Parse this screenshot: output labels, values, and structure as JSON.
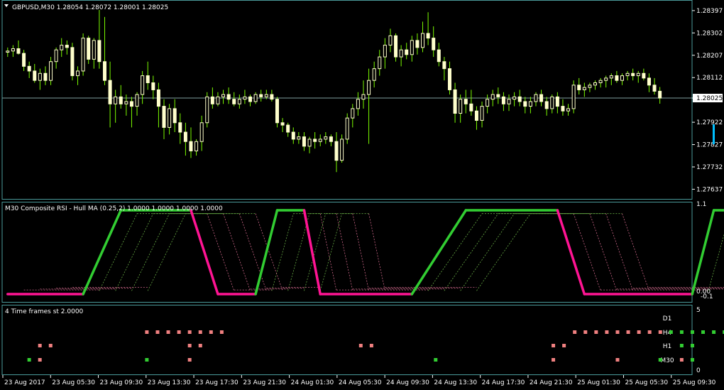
{
  "chart_data": [
    {
      "type": "candlestick",
      "title": "GBPUSD,M30  1.28054 1.28072 1.28001 1.28025",
      "symbol": "GBPUSD",
      "timeframe": "M30",
      "ohlc_header": {
        "open": "1.28054",
        "high": "1.28072",
        "low": "1.28001",
        "close": "1.28025"
      },
      "current_price": "1.28025",
      "yticks": [
        "1.28397",
        "1.28302",
        "1.28207",
        "1.28112",
        "1.28025",
        "1.27922",
        "1.27827",
        "1.27732",
        "1.27637"
      ],
      "ylim": [
        1.27605,
        1.2843
      ],
      "colors": {
        "bull": "#ffffcc",
        "bear": "#ffffcc",
        "wick": "#7cfc00",
        "price_line": "#7fa0a0"
      },
      "candles": [
        [
          1.2822,
          1.2824,
          1.282,
          1.28225
        ],
        [
          1.28225,
          1.2825,
          1.282,
          1.28235
        ],
        [
          1.28235,
          1.2827,
          1.2821,
          1.28215
        ],
        [
          1.28215,
          1.2823,
          1.2814,
          1.2816
        ],
        [
          1.2816,
          1.2818,
          1.2811,
          1.2814
        ],
        [
          1.2814,
          1.2817,
          1.2809,
          1.281
        ],
        [
          1.281,
          1.2815,
          1.2806,
          1.2813
        ],
        [
          1.2813,
          1.2816,
          1.2808,
          1.281
        ],
        [
          1.281,
          1.282,
          1.2808,
          1.2818
        ],
        [
          1.2818,
          1.2824,
          1.2815,
          1.2823
        ],
        [
          1.2823,
          1.2828,
          1.282,
          1.2825
        ],
        [
          1.2825,
          1.2827,
          1.2821,
          1.2824
        ],
        [
          1.2824,
          1.2826,
          1.281,
          1.2812
        ],
        [
          1.2812,
          1.2816,
          1.2808,
          1.2814
        ],
        [
          1.2814,
          1.283,
          1.2812,
          1.2828
        ],
        [
          1.2828,
          1.2829,
          1.2817,
          1.2819
        ],
        [
          1.2819,
          1.2828,
          1.2815,
          1.2827
        ],
        [
          1.2827,
          1.284,
          1.2815,
          1.2818
        ],
        [
          1.2818,
          1.2837,
          1.2808,
          1.281
        ],
        [
          1.281,
          1.2818,
          1.279,
          1.28
        ],
        [
          1.28,
          1.2806,
          1.2792,
          1.2803
        ],
        [
          1.2803,
          1.2808,
          1.2798,
          1.28
        ],
        [
          1.28,
          1.2804,
          1.2795,
          1.2801
        ],
        [
          1.2801,
          1.2803,
          1.279,
          1.2799
        ],
        [
          1.2799,
          1.2805,
          1.2795,
          1.2804
        ],
        [
          1.2804,
          1.2814,
          1.28,
          1.2812
        ],
        [
          1.2812,
          1.2818,
          1.2806,
          1.2809
        ],
        [
          1.2809,
          1.2812,
          1.2802,
          1.2806
        ],
        [
          1.2806,
          1.2809,
          1.279,
          1.2799
        ],
        [
          1.2799,
          1.2802,
          1.2785,
          1.279
        ],
        [
          1.279,
          1.28,
          1.2787,
          1.2798
        ],
        [
          1.2798,
          1.2802,
          1.2788,
          1.2792
        ],
        [
          1.2792,
          1.2796,
          1.2783,
          1.2788
        ],
        [
          1.2788,
          1.2792,
          1.2778,
          1.2784
        ],
        [
          1.2784,
          1.279,
          1.2777,
          1.278
        ],
        [
          1.278,
          1.2785,
          1.2778,
          1.2784
        ],
        [
          1.2784,
          1.2795,
          1.278,
          1.2792
        ],
        [
          1.2792,
          1.2805,
          1.279,
          1.2803
        ],
        [
          1.2803,
          1.2807,
          1.2798,
          1.28
        ],
        [
          1.28,
          1.2805,
          1.2799,
          1.2803
        ],
        [
          1.2803,
          1.2806,
          1.28,
          1.2804
        ],
        [
          1.2804,
          1.2807,
          1.28,
          1.2802
        ],
        [
          1.2802,
          1.2805,
          1.2799,
          1.28
        ],
        [
          1.28,
          1.2804,
          1.2798,
          1.2802
        ],
        [
          1.2802,
          1.2806,
          1.28,
          1.2803
        ],
        [
          1.2803,
          1.2804,
          1.2799,
          1.2801
        ],
        [
          1.2801,
          1.2805,
          1.28,
          1.2804
        ],
        [
          1.2804,
          1.2806,
          1.2801,
          1.2803
        ],
        [
          1.2803,
          1.2806,
          1.2802,
          1.2804
        ],
        [
          1.2804,
          1.2806,
          1.2801,
          1.2802
        ],
        [
          1.2802,
          1.2803,
          1.279,
          1.2792
        ],
        [
          1.2792,
          1.2794,
          1.2788,
          1.2791
        ],
        [
          1.2791,
          1.2792,
          1.2786,
          1.2788
        ],
        [
          1.2788,
          1.279,
          1.2783,
          1.2785
        ],
        [
          1.2785,
          1.2788,
          1.2783,
          1.2786
        ],
        [
          1.2786,
          1.2788,
          1.278,
          1.2782
        ],
        [
          1.2782,
          1.2786,
          1.2779,
          1.2785
        ],
        [
          1.2785,
          1.2788,
          1.2781,
          1.2784
        ],
        [
          1.2784,
          1.2787,
          1.2782,
          1.2785
        ],
        [
          1.2785,
          1.2788,
          1.2783,
          1.2786
        ],
        [
          1.2786,
          1.2787,
          1.2782,
          1.2784
        ],
        [
          1.2784,
          1.2788,
          1.2771,
          1.2776
        ],
        [
          1.2776,
          1.2787,
          1.2775,
          1.2785
        ],
        [
          1.2785,
          1.2796,
          1.2783,
          1.2794
        ],
        [
          1.2794,
          1.28,
          1.279,
          1.2798
        ],
        [
          1.2798,
          1.2805,
          1.2795,
          1.2802
        ],
        [
          1.2802,
          1.281,
          1.2798,
          1.2804
        ],
        [
          1.2804,
          1.2815,
          1.2783,
          1.281
        ],
        [
          1.281,
          1.2818,
          1.2807,
          1.2815
        ],
        [
          1.2815,
          1.2823,
          1.2812,
          1.282
        ],
        [
          1.282,
          1.2828,
          1.2815,
          1.2825
        ],
        [
          1.2825,
          1.2832,
          1.2822,
          1.2829
        ],
        [
          1.2829,
          1.283,
          1.2818,
          1.282
        ],
        [
          1.282,
          1.2825,
          1.2816,
          1.2823
        ],
        [
          1.2823,
          1.2826,
          1.2819,
          1.2821
        ],
        [
          1.2821,
          1.2829,
          1.2818,
          1.2827
        ],
        [
          1.2827,
          1.283,
          1.2821,
          1.2824
        ],
        [
          1.2824,
          1.2835,
          1.2822,
          1.283
        ],
        [
          1.283,
          1.2839,
          1.2825,
          1.2828
        ],
        [
          1.2828,
          1.2833,
          1.282,
          1.2823
        ],
        [
          1.2823,
          1.2826,
          1.2816,
          1.2818
        ],
        [
          1.2818,
          1.282,
          1.281,
          1.2815
        ],
        [
          1.2815,
          1.2818,
          1.2804,
          1.2806
        ],
        [
          1.2806,
          1.2809,
          1.2792,
          1.2796
        ],
        [
          1.2796,
          1.2804,
          1.2792,
          1.2802
        ],
        [
          1.2802,
          1.2806,
          1.2796,
          1.28
        ],
        [
          1.28,
          1.2806,
          1.2795,
          1.2797
        ],
        [
          1.2797,
          1.2799,
          1.2789,
          1.2793
        ],
        [
          1.2793,
          1.2801,
          1.279,
          1.2799
        ],
        [
          1.2799,
          1.2804,
          1.2796,
          1.2802
        ],
        [
          1.2802,
          1.2806,
          1.2799,
          1.2804
        ],
        [
          1.2804,
          1.2807,
          1.28,
          1.2803
        ],
        [
          1.2803,
          1.2805,
          1.2797,
          1.28
        ],
        [
          1.28,
          1.2804,
          1.2797,
          1.2802
        ],
        [
          1.2802,
          1.2805,
          1.2799,
          1.2803
        ],
        [
          1.2803,
          1.2806,
          1.2799,
          1.2801
        ],
        [
          1.2801,
          1.2803,
          1.2796,
          1.2799
        ],
        [
          1.2799,
          1.2803,
          1.2796,
          1.2801
        ],
        [
          1.2801,
          1.2805,
          1.2799,
          1.2804
        ],
        [
          1.2804,
          1.2806,
          1.2799,
          1.2801
        ],
        [
          1.2801,
          1.2803,
          1.2795,
          1.2798
        ],
        [
          1.2798,
          1.2804,
          1.2796,
          1.2803
        ],
        [
          1.2803,
          1.2805,
          1.2796,
          1.2799
        ],
        [
          1.2799,
          1.2802,
          1.2795,
          1.2797
        ],
        [
          1.2797,
          1.28,
          1.2795,
          1.2798
        ],
        [
          1.2798,
          1.281,
          1.2796,
          1.2808
        ],
        [
          1.2808,
          1.2811,
          1.2804,
          1.2806
        ],
        [
          1.2806,
          1.2809,
          1.2803,
          1.2807
        ],
        [
          1.2807,
          1.2809,
          1.2805,
          1.2808
        ],
        [
          1.2808,
          1.281,
          1.2806,
          1.2809
        ],
        [
          1.2809,
          1.2811,
          1.2807,
          1.281
        ],
        [
          1.281,
          1.2812,
          1.2807,
          1.2811
        ],
        [
          1.2811,
          1.2813,
          1.2808,
          1.2812
        ],
        [
          1.2812,
          1.2814,
          1.2809,
          1.281
        ],
        [
          1.281,
          1.2813,
          1.2808,
          1.2812
        ],
        [
          1.2812,
          1.2814,
          1.281,
          1.2813
        ],
        [
          1.2813,
          1.2815,
          1.281,
          1.2812
        ],
        [
          1.2812,
          1.2814,
          1.2809,
          1.2813
        ],
        [
          1.2813,
          1.2815,
          1.281,
          1.2811
        ],
        [
          1.2811,
          1.2813,
          1.2805,
          1.2808
        ],
        [
          1.2808,
          1.2811,
          1.2804,
          1.28054
        ],
        [
          1.28054,
          1.28072,
          1.28001,
          1.28025
        ]
      ],
      "xticks": [
        "23 Aug 2017",
        "23 Aug 05:30",
        "23 Aug 09:30",
        "23 Aug 13:30",
        "23 Aug 17:30",
        "23 Aug 21:30",
        "24 Aug 01:30",
        "24 Aug 05:30",
        "24 Aug 09:30",
        "24 Aug 13:30",
        "24 Aug 17:30",
        "24 Aug 21:30",
        "25 Aug 01:30",
        "25 Aug 05:30",
        "25 Aug 09:30"
      ]
    },
    {
      "type": "line",
      "title": "M30 Composite RSI - Hull MA (0.25,2) 1.0000 1.0000 1.0000 1.0000",
      "yticks": [
        "1.1",
        "0.00",
        "-0.1"
      ],
      "ylim": [
        -0.1,
        1.1
      ],
      "colors": {
        "up": "#32cd32",
        "down": "#ff1493",
        "faint_up": "#66aa44",
        "faint_down": "#cc6688"
      },
      "segments": [
        {
          "from": 0,
          "to": 14,
          "value": "low",
          "color": "down"
        },
        {
          "from": 14,
          "to": 21,
          "value": "rise",
          "color": "up"
        },
        {
          "from": 21,
          "to": 34,
          "value": "high",
          "color": "up"
        },
        {
          "from": 34,
          "to": 39,
          "value": "fall",
          "color": "down"
        },
        {
          "from": 39,
          "to": 46,
          "value": "low",
          "color": "down"
        },
        {
          "from": 46,
          "to": 50,
          "value": "rise",
          "color": "up"
        },
        {
          "from": 50,
          "to": 55,
          "value": "high",
          "color": "up"
        },
        {
          "from": 55,
          "to": 58,
          "value": "fall",
          "color": "down"
        },
        {
          "from": 58,
          "to": 75,
          "value": "low",
          "color": "down"
        },
        {
          "from": 75,
          "to": 85,
          "value": "rise",
          "color": "up"
        },
        {
          "from": 85,
          "to": 102,
          "value": "high",
          "color": "up"
        },
        {
          "from": 102,
          "to": 107,
          "value": "fall",
          "color": "down"
        },
        {
          "from": 107,
          "to": 127,
          "value": "low",
          "color": "down"
        },
        {
          "from": 127,
          "to": 131,
          "value": "rise",
          "color": "up"
        },
        {
          "from": 131,
          "to": 158,
          "value": "high",
          "color": "up"
        },
        {
          "from": 158,
          "to": 164,
          "value": "fall",
          "color": "down"
        },
        {
          "from": 164,
          "to": 200,
          "value": "low",
          "color": "down"
        },
        {
          "from": 200,
          "to": 209,
          "value": "rise",
          "color": "up"
        },
        {
          "from": 209,
          "to": 227,
          "value": "high",
          "color": "up"
        }
      ]
    },
    {
      "type": "heatmap",
      "title": "4 Time frames st 2.0000",
      "yticks": [
        "5",
        "0"
      ],
      "rows": [
        "D1",
        "H4",
        "H1",
        "M30"
      ],
      "colors": {
        "up": "#32cd32",
        "down": "#f08080"
      },
      "cells": {
        "H4": [
          [
            26,
            "down"
          ],
          [
            28,
            "down"
          ],
          [
            30,
            "down"
          ],
          [
            32,
            "down"
          ],
          [
            34,
            "down"
          ],
          [
            36,
            "down"
          ],
          [
            38,
            "down"
          ],
          [
            40,
            "down"
          ],
          [
            106,
            "down"
          ],
          [
            108,
            "down"
          ],
          [
            110,
            "down"
          ],
          [
            112,
            "down"
          ],
          [
            114,
            "down"
          ],
          [
            116,
            "down"
          ],
          [
            118,
            "down"
          ],
          [
            120,
            "down"
          ],
          [
            122,
            "down"
          ],
          [
            124,
            "up"
          ],
          [
            126,
            "up"
          ],
          [
            128,
            "up"
          ],
          [
            130,
            "up"
          ],
          [
            132,
            "up"
          ],
          [
            134,
            "up"
          ],
          [
            136,
            "up"
          ]
        ],
        "H1": [
          [
            6,
            "down"
          ],
          [
            8,
            "down"
          ],
          [
            34,
            "down"
          ],
          [
            36,
            "down"
          ],
          [
            66,
            "down"
          ],
          [
            68,
            "down"
          ],
          [
            102,
            "down"
          ],
          [
            104,
            "down"
          ],
          [
            126,
            "up"
          ],
          [
            128,
            "up"
          ],
          [
            154,
            "down"
          ],
          [
            156,
            "down"
          ],
          [
            166,
            "down"
          ],
          [
            168,
            "down"
          ],
          [
            222,
            "down"
          ],
          [
            224,
            "down"
          ]
        ],
        "M30": [
          [
            4,
            "up"
          ],
          [
            6,
            "down"
          ],
          [
            26,
            "up"
          ],
          [
            34,
            "down"
          ],
          [
            80,
            "up"
          ],
          [
            102,
            "down"
          ],
          [
            114,
            "down"
          ],
          [
            122,
            "up"
          ],
          [
            126,
            "down"
          ],
          [
            128,
            "up"
          ],
          [
            154,
            "down"
          ],
          [
            166,
            "down"
          ],
          [
            182,
            "down"
          ],
          [
            200,
            "up"
          ],
          [
            220,
            "down"
          ]
        ]
      }
    }
  ]
}
